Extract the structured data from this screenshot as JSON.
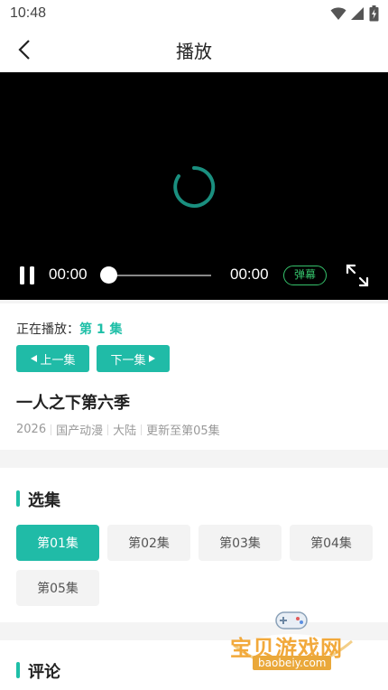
{
  "status_bar": {
    "time": "10:48"
  },
  "app_bar": {
    "title": "播放"
  },
  "player": {
    "current_time": "00:00",
    "total_time": "00:00",
    "progress": 0,
    "danmaku_label": "弹幕"
  },
  "info": {
    "now_playing_label": "正在播放：",
    "now_playing_episode": "第 1 集",
    "prev_label": "上一集",
    "next_label": "下一集",
    "show_title": "一人之下第六季",
    "meta": [
      "2026",
      "国产动漫",
      "大陆",
      "更新至第05集"
    ]
  },
  "episodes": {
    "section_title": "选集",
    "items": [
      "第01集",
      "第02集",
      "第03集",
      "第04集",
      "第05集"
    ],
    "selected_index": 0
  },
  "comments": {
    "section_title": "评论"
  },
  "watermark": {
    "text": "宝贝游戏网",
    "url": "baobeiy.com"
  },
  "colors": {
    "accent": "#20bba7",
    "danmaku": "#35c26b"
  }
}
